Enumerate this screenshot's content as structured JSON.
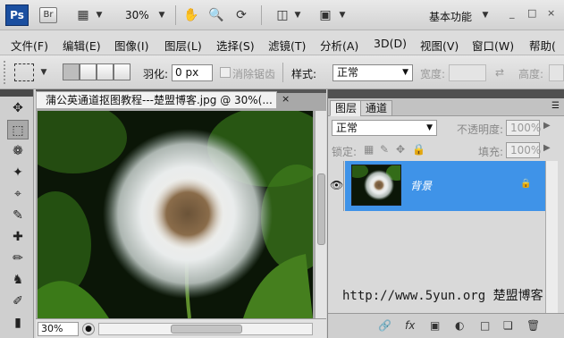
{
  "app": {
    "logo": "Ps",
    "bridge": "Br",
    "zoom": "30%",
    "workspace": "基本功能",
    "window_controls": [
      "_",
      "□",
      "×"
    ]
  },
  "menu": [
    "文件(F)",
    "编辑(E)",
    "图像(I)",
    "图层(L)",
    "选择(S)",
    "滤镜(T)",
    "分析(A)",
    "3D(D)",
    "视图(V)",
    "窗口(W)",
    "帮助("
  ],
  "options": {
    "feather_label": "羽化:",
    "feather_value": "0 px",
    "antialias_label": "消除锯齿",
    "style_label": "样式:",
    "style_value": "正常",
    "width_label": "宽度:",
    "height_label": "高度:"
  },
  "document": {
    "title": "蒲公英通道抠图教程---楚盟博客.jpg @ 30%(...",
    "close": "×",
    "zoom": "30%"
  },
  "panel": {
    "tabs": [
      "图层",
      "通道"
    ],
    "blend_mode": "正常",
    "opacity_label": "不透明度:",
    "opacity_value": "100%",
    "lock_label": "锁定:",
    "fill_label": "填充:",
    "fill_value": "100%",
    "layer_name": "背景",
    "watermark": "http://www.5yun.org 楚盟博客"
  },
  "colors": {
    "selected_layer": "#3f93e8",
    "ps_logo": "#1b4fa0"
  }
}
